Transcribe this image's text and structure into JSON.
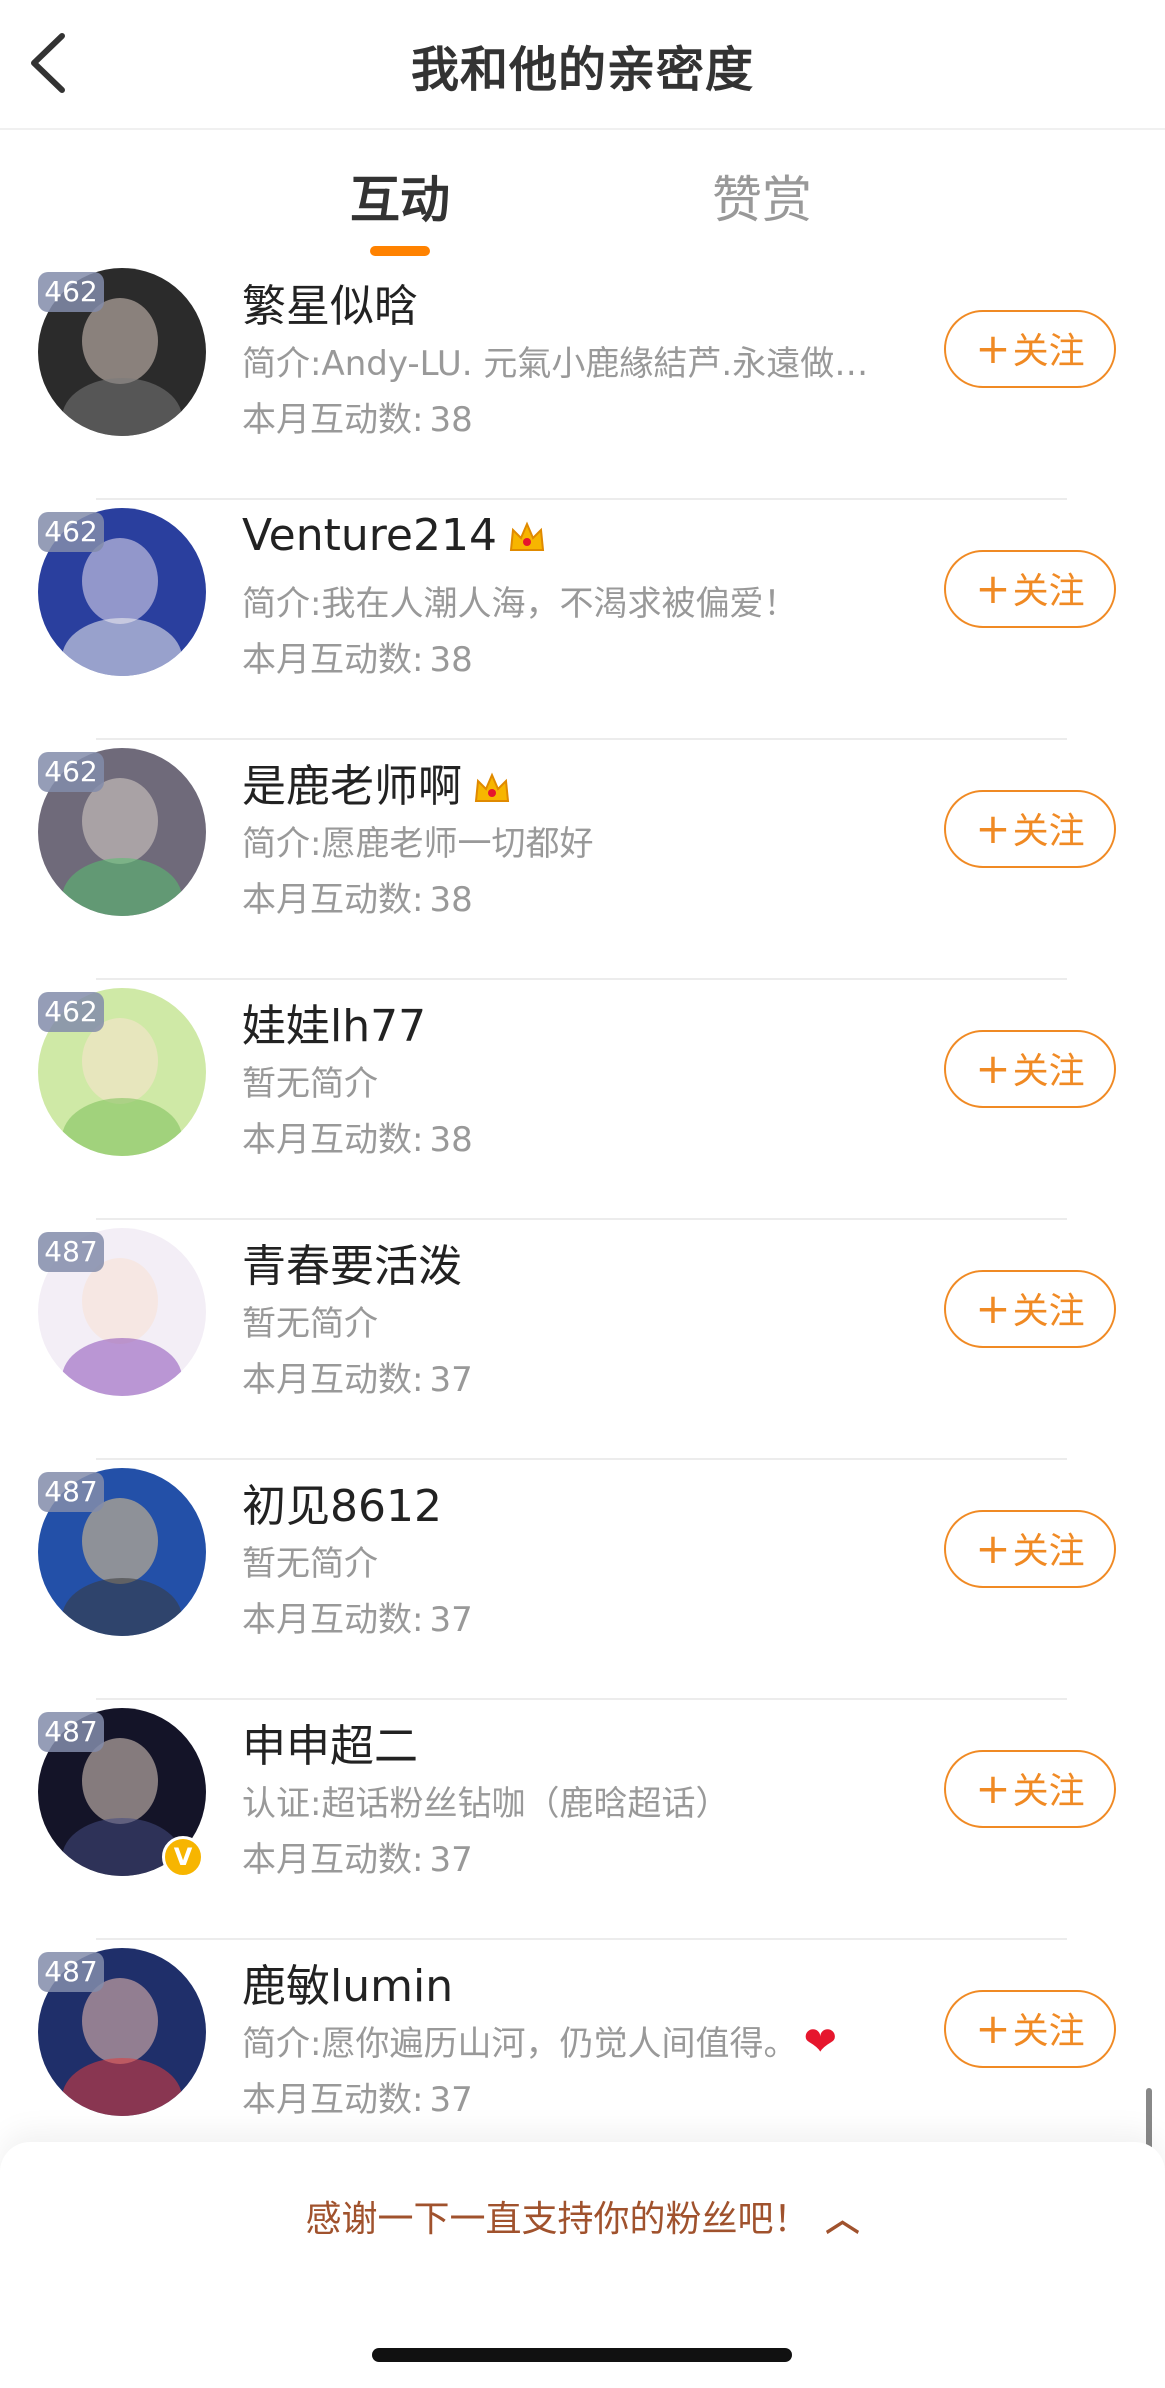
{
  "header": {
    "title": "我和他的亲密度"
  },
  "tabs": {
    "active": "互动",
    "inactive": "赞赏"
  },
  "rows": [
    {
      "name": "繁星似晗",
      "bio": "简介:Andy-LU. 元氣小鹿緣結芦.永遠做…",
      "count_label": "本月互动数:",
      "count": "38",
      "badge": "462",
      "follow": "关注"
    },
    {
      "name": "Venture214",
      "bio": "简介:我在人潮人海，不渴求被偏爱！",
      "count_label": "本月互动数:",
      "count": "38",
      "badge": "462",
      "follow": "关注"
    },
    {
      "name": "是鹿老师啊",
      "bio": "简介:愿鹿老师一切都好",
      "count_label": "本月互动数:",
      "count": "38",
      "badge": "462",
      "follow": "关注"
    },
    {
      "name": "娃娃lh77",
      "bio": "暂无简介",
      "count_label": "本月互动数:",
      "count": "38",
      "badge": "462",
      "follow": "关注"
    },
    {
      "name": "青春要活泼",
      "bio": "暂无简介",
      "count_label": "本月互动数:",
      "count": "37",
      "badge": "487",
      "follow": "关注"
    },
    {
      "name": "初见8612",
      "bio": "暂无简介",
      "count_label": "本月互动数:",
      "count": "37",
      "badge": "487",
      "follow": "关注"
    },
    {
      "name": "申申超二",
      "bio": "认证:超话粉丝钻咖（鹿晗超话）",
      "count_label": "本月互动数:",
      "count": "37",
      "badge": "487",
      "follow": "关注"
    },
    {
      "name": "鹿敏lumin",
      "bio": "简介:愿你遍历山河，仍觉人间值得。",
      "count_label": "本月互动数:",
      "count": "37",
      "badge": "487",
      "follow": "关注"
    }
  ],
  "footer": {
    "thanks": "感谢一下一直支持你的粉丝吧！"
  },
  "colors": {
    "accent": "#ff8200",
    "follow": "#f08a24",
    "thanks": "#a0522d"
  }
}
